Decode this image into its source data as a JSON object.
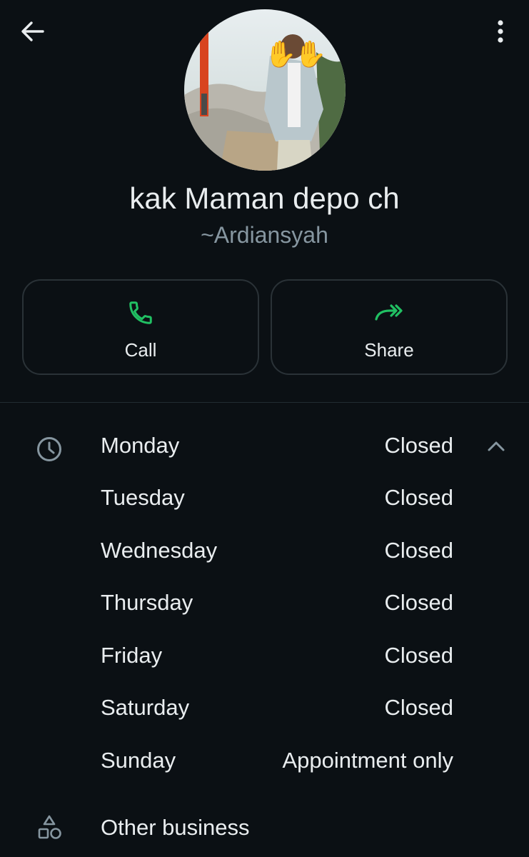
{
  "contact": {
    "name": "kak Maman depo ch",
    "pushname": "~Ardiansyah"
  },
  "actions": {
    "call_label": "Call",
    "share_label": "Share"
  },
  "hours": [
    {
      "day": "Monday",
      "status": "Closed"
    },
    {
      "day": "Tuesday",
      "status": "Closed"
    },
    {
      "day": "Wednesday",
      "status": "Closed"
    },
    {
      "day": "Thursday",
      "status": "Closed"
    },
    {
      "day": "Friday",
      "status": "Closed"
    },
    {
      "day": "Saturday",
      "status": "Closed"
    },
    {
      "day": "Sunday",
      "status": "Appointment only"
    }
  ],
  "other_business": {
    "label": "Other business"
  },
  "colors": {
    "background": "#0b1014",
    "accent_green": "#21c063",
    "icon_gray": "#8696a0",
    "border": "#2a3237"
  },
  "icons": {
    "back": "arrow-left-icon",
    "menu": "more-vertical-icon",
    "call": "phone-icon",
    "share": "share-forward-icon",
    "hours": "clock-icon",
    "collapse": "chevron-up-icon",
    "other_business": "shapes-icon"
  }
}
